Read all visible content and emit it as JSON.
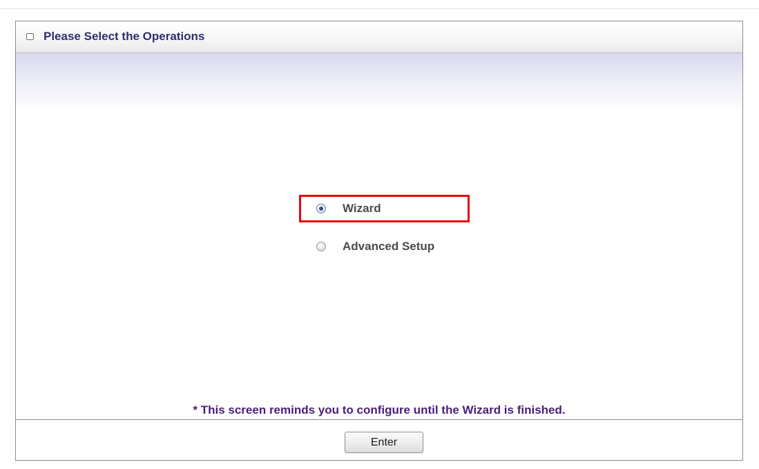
{
  "header": {
    "title": "Please Select the Operations",
    "bullet_icon": "square-bullet-icon"
  },
  "options": [
    {
      "label": "Wizard",
      "checked": true,
      "highlighted": true
    },
    {
      "label": "Advanced Setup",
      "checked": false,
      "highlighted": false
    }
  ],
  "reminder": "* This screen reminds you to configure until the Wizard is finished.",
  "actions": {
    "enter_label": "Enter"
  },
  "colors": {
    "title_text": "#2e2e6e",
    "reminder_text": "#4b1d7a",
    "highlight_border": "#e8000d",
    "header_glow": "#d9d9f0"
  }
}
